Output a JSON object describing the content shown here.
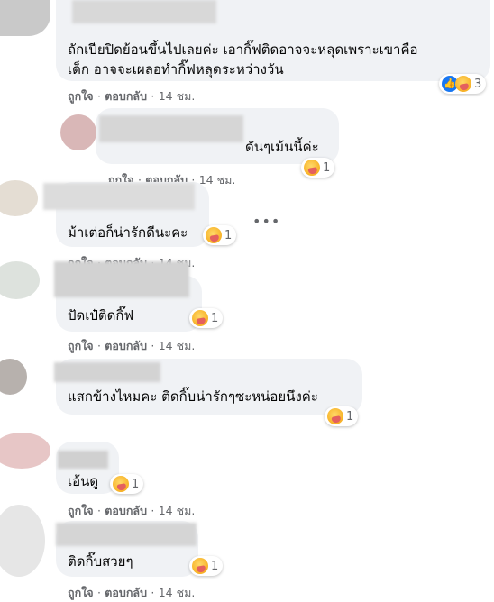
{
  "actions": {
    "like_label": "ถูกใจ",
    "reply_label": "ตอบกลับ",
    "sep": "·",
    "time": "14 ชม."
  },
  "icons": {
    "reaction_like": "thumbs-up-icon",
    "reaction_care": "care-hug-icon",
    "more_options": "more-options-icon"
  },
  "comments": [
    {
      "lines": [
        "ถักเปียปิดย้อนขึ้นไปเลยค่ะ เอากิ๊ฟติดอาจจะหลุดเพราะเขาคือ",
        "เด็ก อาจจะเผลอทำกิ๊ฟหลุดระหว่างวัน"
      ],
      "reaction_count": "3"
    },
    {
      "lines": [
        "ดันๆเม้นนี้ค่ะ"
      ],
      "reaction_count": "1"
    },
    {
      "lines": [
        "ม้าเต่อก็น่ารักดีนะคะ"
      ],
      "reaction_count": "1"
    },
    {
      "lines": [
        "ปัดเป๋ติดกิ๊ฟ"
      ],
      "reaction_count": "1"
    },
    {
      "lines": [
        "แสกข้างไหมคะ ติดกิ๊บน่ารักๆซะหน่อยนึงค่ะ"
      ],
      "reaction_count": "1"
    },
    {
      "lines": [
        "เอ้นดู"
      ],
      "reaction_count": "1"
    },
    {
      "lines": [
        "ติดกิ๊บสวยๆ"
      ],
      "reaction_count": "1"
    }
  ]
}
